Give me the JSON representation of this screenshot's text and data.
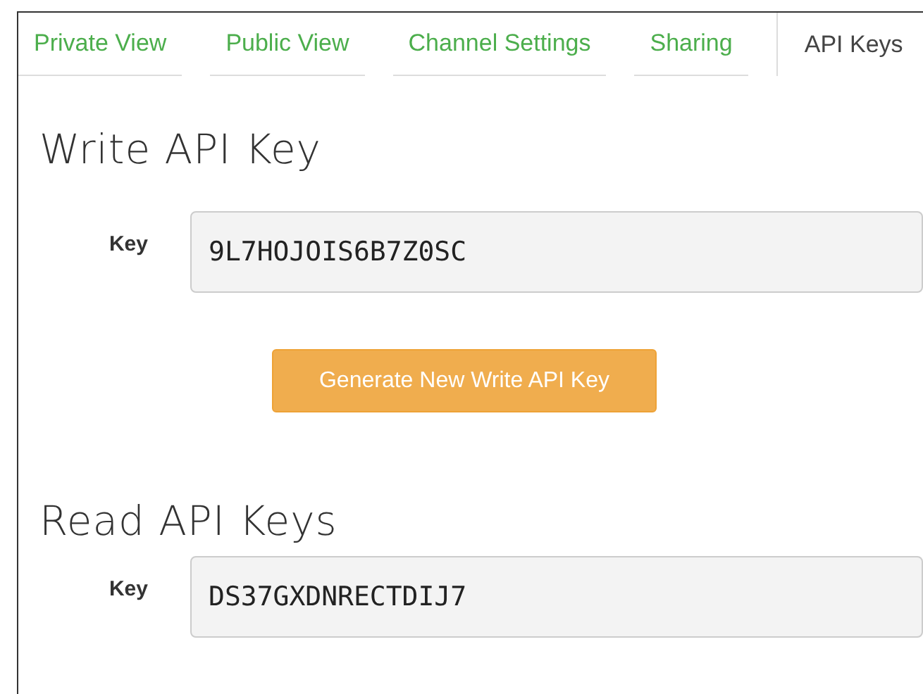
{
  "tabs": [
    {
      "label": "Private View",
      "selected": false
    },
    {
      "label": "Public View",
      "selected": false
    },
    {
      "label": "Channel Settings",
      "selected": false
    },
    {
      "label": "Sharing",
      "selected": false
    },
    {
      "label": "API Keys",
      "selected": true
    }
  ],
  "write_section": {
    "heading": "Write API Key",
    "key_label": "Key",
    "key_value": "9L7HOJOIS6B7Z0SC",
    "button": "Generate New Write API Key"
  },
  "read_section": {
    "heading": "Read API Keys",
    "key_label": "Key",
    "key_value": "DS37GXDNRECTDIJ7"
  }
}
